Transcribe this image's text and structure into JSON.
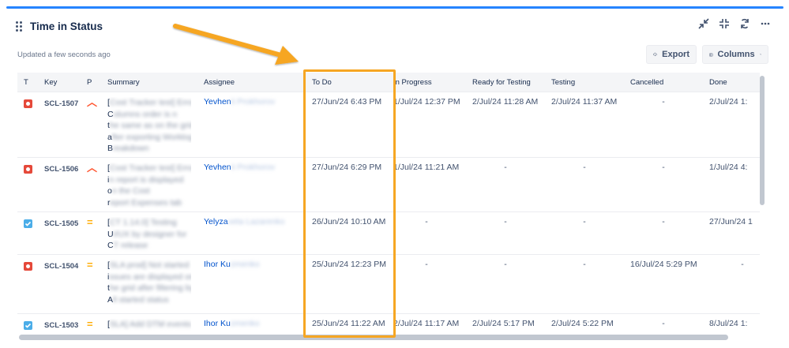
{
  "widget": {
    "title": "Time in Status",
    "updated": "Updated a few seconds ago",
    "accent_color": "#2684ff",
    "header_icons": [
      "collapse-icon",
      "minimize-icon",
      "refresh-icon",
      "more-icon"
    ]
  },
  "toolbar": {
    "export_label": "Export",
    "columns_label": "Columns"
  },
  "table": {
    "headers": {
      "t": "T",
      "key": "Key",
      "p": "P",
      "summary": "Summary",
      "assignee": "Assignee",
      "todo": "To Do",
      "inprogress": "In Progress",
      "ready": "Ready for Testing",
      "testing": "Testing",
      "cancelled": "Cancelled",
      "done": "Done"
    },
    "rows": [
      {
        "type": "bug",
        "priority": "high",
        "key": "SCL-1507",
        "summary_vis": [
          "[",
          "C",
          "t",
          "a",
          "B"
        ],
        "summary_blur": [
          "Cost Tracker test] Error",
          "olumns order is n",
          "he same as on the grid",
          "fter exporting Worklog",
          "reakdown"
        ],
        "assignee_vis": "Yevhen",
        "assignee_blur": "ii Prokhorov",
        "todo": "27/Jun/24 6:43 PM",
        "inprogress": "1/Jul/24 12:37 PM",
        "ready": "2/Jul/24 11:28 AM",
        "testing": "2/Jul/24 11:37 AM",
        "cancelled": "-",
        "done": "2/Jul/24 1:"
      },
      {
        "type": "bug",
        "priority": "high",
        "key": "SCL-1506",
        "summary_vis": [
          "[",
          "i",
          "o",
          "r"
        ],
        "summary_blur": [
          "Cost Tracker test] Error",
          "n report is displayed",
          "n the Cost",
          "eport Expenses tab"
        ],
        "assignee_vis": "Yevhen",
        "assignee_blur": "ii Prokhorov",
        "todo": "27/Jun/24 6:29 PM",
        "inprogress": "1/Jul/24 11:21 AM",
        "ready": "-",
        "testing": "-",
        "cancelled": "-",
        "done": "1/Jul/24 4:"
      },
      {
        "type": "task",
        "priority": "medium",
        "key": "SCL-1505",
        "summary_vis": [
          "[",
          "U",
          "C"
        ],
        "summary_blur": [
          "CT 1.14.0] Testing",
          "I/UX by designer for",
          "T release"
        ],
        "assignee_vis": "Yelyza",
        "assignee_blur": "veta Lazarenko",
        "todo": "26/Jun/24 10:10 AM",
        "inprogress": "-",
        "ready": "-",
        "testing": "-",
        "cancelled": "-",
        "done": "27/Jun/24 1"
      },
      {
        "type": "bug",
        "priority": "medium",
        "key": "SCL-1504",
        "summary_vis": [
          "[",
          "i",
          "t",
          "A"
        ],
        "summary_blur": [
          "SLA prod] Not started",
          "ssues are displayed on",
          "he grid after filtering by",
          "ll started status"
        ],
        "assignee_vis": "Ihor Ku",
        "assignee_blur": "zmenko",
        "todo": "25/Jun/24 12:23 PM",
        "inprogress": "-",
        "ready": "-",
        "testing": "-",
        "cancelled": "16/Jul/24 5:29 PM",
        "done": "-"
      },
      {
        "type": "task",
        "priority": "medium",
        "key": "SCL-1503",
        "summary_vis": [
          "["
        ],
        "summary_blur": [
          "SLA] Add DTM events"
        ],
        "assignee_vis": "Ihor Ku",
        "assignee_blur": "zmenko",
        "todo": "25/Jun/24 11:22 AM",
        "inprogress": "2/Jul/24 11:17 AM",
        "ready": "2/Jul/24 5:17 PM",
        "testing": "2/Jul/24 5:22 PM",
        "cancelled": "-",
        "done": "8/Jul/24 1:"
      }
    ]
  }
}
